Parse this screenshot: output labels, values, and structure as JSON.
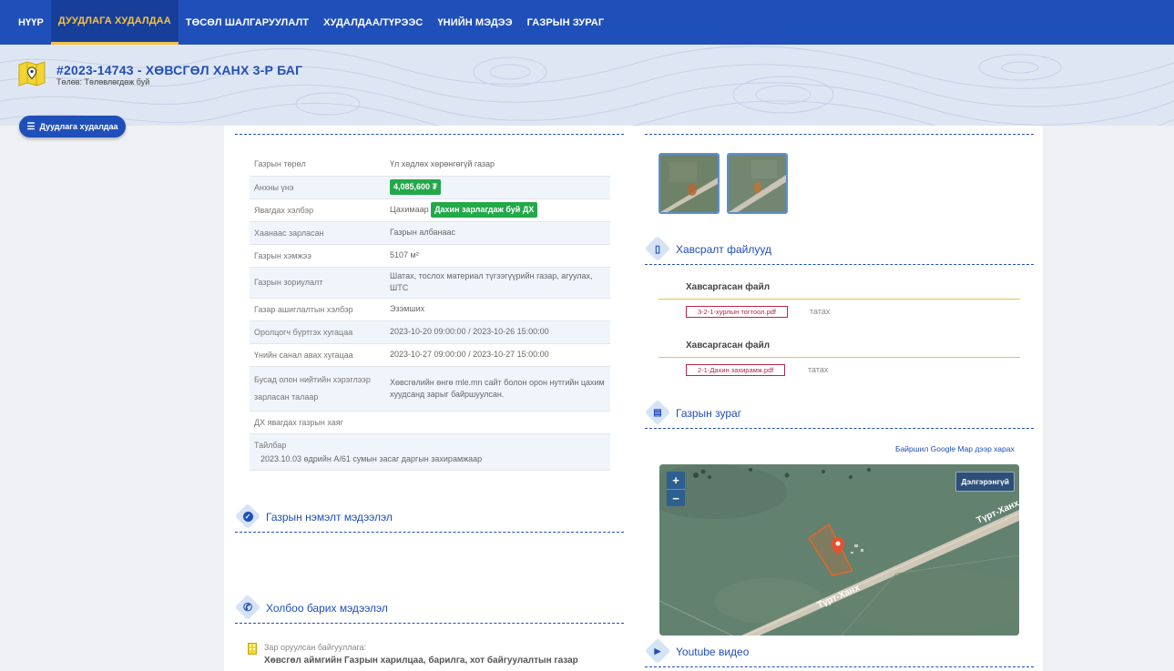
{
  "nav": {
    "items": [
      {
        "label": "НҮҮР"
      },
      {
        "label": "ДУУДЛАГА ХУДАЛДАА"
      },
      {
        "label": "ТӨСӨЛ ШАЛГАРУУЛАЛТ"
      },
      {
        "label": "ХУДАЛДАА/ТҮРЭЭС"
      },
      {
        "label": "ҮНИЙН МЭДЭЭ"
      },
      {
        "label": "ГАЗРЫН ЗУРАГ"
      }
    ]
  },
  "header": {
    "title": "#2023-14743 - ХӨВСГӨЛ ХАНХ 3-Р БАГ",
    "status": "Төлөв: Төлөвлөгдөж буй"
  },
  "auction_button": {
    "label": "Дуудлага худалдаа",
    "icon": "list-icon"
  },
  "details": {
    "rows": [
      {
        "key": "Газрын төрөл",
        "value": "Үл хөдлөх хөрөнгөгүй газар"
      },
      {
        "key": "Анхны үнэ",
        "badge": "4,085,600 ₮"
      },
      {
        "key": "Явагдах хэлбэр",
        "value": "Цахимаар",
        "badge": "Дахин зарлагдаж буй ДХ"
      },
      {
        "key": "Хаанаас зарласан",
        "value": "Газрын албанаас"
      },
      {
        "key": "Газрын хэмжээ",
        "value": "5107 м²"
      },
      {
        "key": "Газрын зориулалт",
        "value": "Шатах, тослох материал түгээгүүрийн газар, агуулах, ШТС"
      },
      {
        "key": "Газар ашиглалтын хэлбэр",
        "value": "Эзэмших"
      },
      {
        "key": "Оролцогч бүртгэх хугацаа",
        "value": "2023-10-20 09:00:00 / 2023-10-26 15:00:00"
      },
      {
        "key": "Үнийн санал авах хугацаа",
        "value": "2023-10-27 09:00:00 / 2023-10-27 15:00:00"
      },
      {
        "key": "Бусад олон нийтийн хэрэглээр зарласан талаар",
        "value": "Хөвсгөлийн өнгө mle.mn сайт болон орон нутгийн цахим хуудсанд зарыг байршуулсан."
      },
      {
        "key": "ДХ явагдах газрын хаяг",
        "value": ""
      },
      {
        "key": "Тайлбар",
        "value": "2023.10.03 өдрийн А/61 сумын засаг даргын захирамжаар"
      }
    ]
  },
  "sections": {
    "extra_info": "Газрын нэмэлт мэдээлэл",
    "contact": "Холбоо барих мэдээлэл",
    "attachments": "Хавсралт файлууд",
    "land_map": "Газрын зураг",
    "youtube": "Youtube видео"
  },
  "attachments": [
    {
      "heading": "Хавсаргасан файл",
      "file": "3-2-1-хурлын тогтоол.pdf",
      "download": "татах"
    },
    {
      "heading": "Хавсаргасан файл",
      "file": "2-1-Дахин захирамж.pdf",
      "download": "татах"
    }
  ],
  "map": {
    "google_link": "Байршил Google Map дээр харах",
    "zoom_in": "+",
    "zoom_out": "−",
    "more_button": "Дэлгэрэнгүй",
    "road_label": "Түрт-Ханх"
  },
  "contact": {
    "org_label": "Зар оруулсан байгууллага:",
    "org_name": "Хөвсгөл аймгийн Газрын харилцаа, барилга, хот байгуулалтын газар"
  },
  "colors": {
    "nav_bg": "#1f4fb8",
    "accent_yellow": "#f5c242",
    "badge_green": "#23a84a",
    "link_red": "#b3274d"
  }
}
